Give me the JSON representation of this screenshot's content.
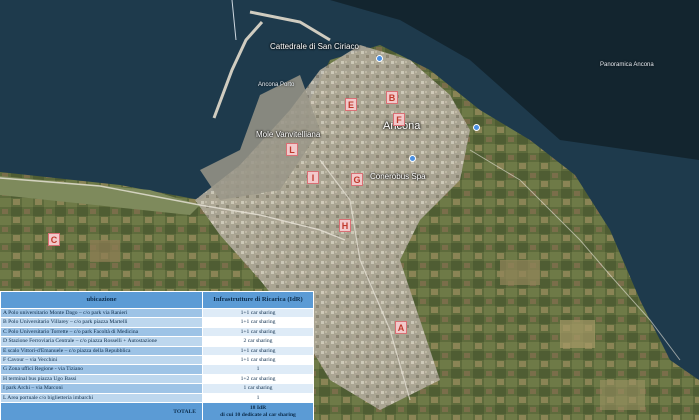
{
  "map": {
    "place_labels": {
      "cathedral": "Cattedrale di San Ciriaco",
      "mole": "Mole Vanvitelliana",
      "city": "Ancona",
      "conerobus": "Conerobus Spa",
      "road_port": "Ancona Porto",
      "road_panoramica": "Panoramica Ancona"
    },
    "markers": [
      "E",
      "B",
      "F",
      "L",
      "I",
      "G",
      "H",
      "C",
      "A"
    ],
    "colors": {
      "sea": "#1e3a4c",
      "land": "#5e6b3c",
      "urban": "#b9b4a6",
      "marker_bg": "#f2c9cb",
      "marker_text": "#c0392b"
    }
  },
  "legend": {
    "headers": {
      "location": "ubicazione",
      "infrastructure": "Infrastrutture di Ricarica (IdR)"
    },
    "rows": [
      {
        "location": "A  Polo universitario Monte Dago – c/o park via Ranieri",
        "infrastructure": "1+1 car sharing"
      },
      {
        "location": "B  Polo Universitario Villarey – c/o park piazza Martelli",
        "infrastructure": "1+1 car sharing"
      },
      {
        "location": "C  Polo Universitario Torrette – c/o park Facoltà di Medicina",
        "infrastructure": "1+1 car sharing"
      },
      {
        "location": "D  Stazione Ferroviaria Centrale – c/o piazza Rosselli + Autostazione",
        "infrastructure": "2 car sharing"
      },
      {
        "location": "E  scalo Vittori-d'Emanuele – c/o piazza della Repubblica",
        "infrastructure": "1+1 car sharing"
      },
      {
        "location": "F  Cavour – via Vecchini",
        "infrastructure": "1+1 car sharing"
      },
      {
        "location": "G  Zona uffici Regione - via Tiziano",
        "infrastructure": "1"
      },
      {
        "location": "H  terminal bus piazza Ugo Bassi",
        "infrastructure": "1+2 car sharing"
      },
      {
        "location": "I  park Archi – via Marconi",
        "infrastructure": "1 car sharing"
      },
      {
        "location": "L  Area portuale c/o biglietteria imbarchi",
        "infrastructure": "1"
      }
    ],
    "total": {
      "label": "TOTALE",
      "value_line1": "18 IdR",
      "value_line2": "di cui 10 dedicate al car sharing"
    }
  }
}
